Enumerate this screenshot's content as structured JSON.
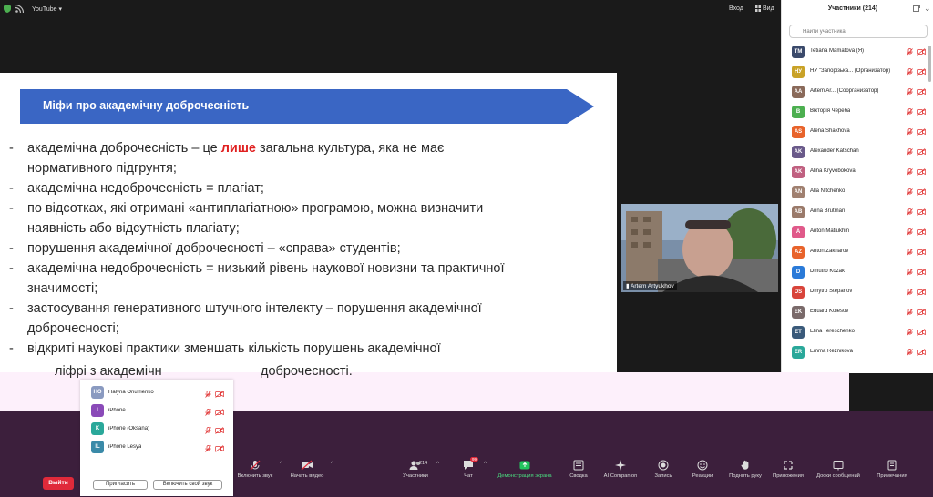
{
  "topbar": {
    "app": "YouTube",
    "signin": "Вход",
    "view": "Вид"
  },
  "slide": {
    "title": "Міфи про академічну доброчесність",
    "colors": {
      "banner": "#3a66c4",
      "highlight": "#e02020"
    },
    "bullets": [
      {
        "pre": "академічна доброчесність – це ",
        "hl": "лише",
        "post": " загальна культура, яка не має"
      },
      {
        "pre": "нормативного підгрунтя;",
        "cont": true
      },
      {
        "pre": "академічна недоброчесність = плагіат;"
      },
      {
        "pre": "по відсотках, які отримані «антиплагіатною» програмою, можна визначити"
      },
      {
        "pre": "наявність або відсутність плагіату;",
        "cont": true
      },
      {
        "pre": "порушення академічної доброчесності – «справа» студентів;"
      },
      {
        "pre": "академічна недоброчесність = низький рівень наукової новизни та практичної"
      },
      {
        "pre": "значимості;",
        "cont": true
      },
      {
        "pre": "застосування генеративного штучного інтелекту – порушення академічної"
      },
      {
        "pre": "доброчесності;",
        "cont": true
      },
      {
        "pre": "відкриті наукові практики зменшать кількість порушень академічної"
      }
    ],
    "last_left": "ліфрі  з академічн",
    "last_right": "доброчесності."
  },
  "video": {
    "name": "Artem Artyukhov"
  },
  "panel": {
    "title": "Участники (214)",
    "search_placeholder": "Найти участника",
    "participants": [
      {
        "initials": "TM",
        "color": "#3b4a6b",
        "name": "Tetiana Mamatova (Я)"
      },
      {
        "initials": "НУ",
        "color": "#c9a227",
        "name": "НУ \"Запорізька... (Организатор)"
      },
      {
        "initials": "AA",
        "color": "#8a6a5a",
        "name": "Artem Ar... (Соорганизатор)"
      },
      {
        "initials": "B",
        "color": "#4caf50",
        "name": "Вікторія Череба"
      },
      {
        "initials": "AS",
        "color": "#e8632b",
        "name": "Alena Shakhova"
      },
      {
        "initials": "AK",
        "color": "#6a5a8a",
        "name": "Alexander Katschan"
      },
      {
        "initials": "AK",
        "color": "#c06080",
        "name": "Alina Kryvobokova"
      },
      {
        "initials": "AN",
        "color": "#a08070",
        "name": "Alla Nitchenko"
      },
      {
        "initials": "AB",
        "color": "#9a7a6a",
        "name": "Anna Brutman"
      },
      {
        "initials": "A",
        "color": "#e05a8a",
        "name": "Anton Matiukhin"
      },
      {
        "initials": "AZ",
        "color": "#e8632b",
        "name": "Anton Zakharov"
      },
      {
        "initials": "D",
        "color": "#2a7ad8",
        "name": "Dmutro Kozak"
      },
      {
        "initials": "DS",
        "color": "#d8443a",
        "name": "Dmytro Stepanov"
      },
      {
        "initials": "EK",
        "color": "#7a6a6a",
        "name": "Eduard Kolesov"
      },
      {
        "initials": "ET",
        "color": "#3a5a7a",
        "name": "Elina Tereschenko"
      },
      {
        "initials": "ER",
        "color": "#2aa89a",
        "name": "Emma Reznikova"
      }
    ]
  },
  "overlay": {
    "rows": [
      {
        "initials": "HO",
        "color": "#8a9ac0",
        "name": "Halyna Onufrienko"
      },
      {
        "initials": "I",
        "color": "#8a4ab8",
        "name": "iPhone"
      },
      {
        "initials": "K",
        "color": "#2aa89a",
        "name": "iPhone (Oksana)"
      },
      {
        "initials": "IL",
        "color": "#3a8aa8",
        "name": "iPhone Lesya"
      }
    ],
    "invite": "Пригласить",
    "unmute": "Включить свой звук"
  },
  "toolbar": {
    "leave": "Выйти",
    "items": {
      "audio": "Включить звук",
      "video": "Начать видео",
      "participants": "Участники",
      "participants_count": "214",
      "chat": "Чат",
      "chat_badge": "99",
      "share": "Демонстрация экрана",
      "summary": "Сводка",
      "ai": "AI Companion",
      "record": "Запись",
      "reactions": "Реакции",
      "raise": "Поднять руку",
      "apps": "Приложения",
      "whiteboard": "Доски сообщений",
      "notes": "Примечания"
    }
  }
}
